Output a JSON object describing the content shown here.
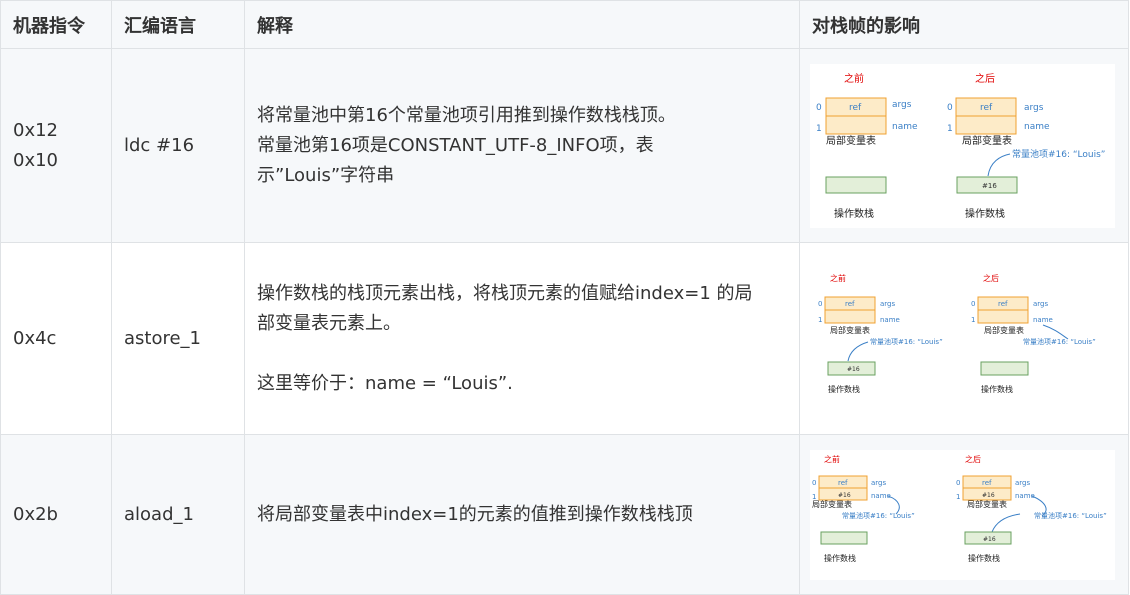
{
  "headers": [
    "机器指令",
    "汇编语言",
    "解释",
    "对栈帧的影响"
  ],
  "rows": [
    {
      "machine": [
        "0x12",
        "0x10"
      ],
      "asm": "ldc #16",
      "explain": [
        "将常量池中第16个常量池项引用推到操作数栈栈顶。",
        "常量池第16项是CONSTANT_UTF-8_INFO项，表",
        "示”Louis”字符串"
      ]
    },
    {
      "machine": [
        "0x4c"
      ],
      "asm": "astore_1",
      "explain": [
        "操作数栈的栈顶元素出栈，将栈顶元素的值赋给index=1 的局",
        "部变量表元素上。",
        "",
        "这里等价于：name = “Louis”."
      ]
    },
    {
      "machine": [
        "0x2b"
      ],
      "asm": "aload_1",
      "explain": [
        "将局部变量表中index=1的元素的值推到操作数栈栈顶"
      ]
    }
  ],
  "diagram": {
    "before": "之前",
    "after": "之后",
    "idx0": "0",
    "idx1": "1",
    "ref": "ref",
    "args": "args",
    "name": "name",
    "lvt": "局部变量表",
    "stack": "操作数栈",
    "const": "常量池项#16: “Louis”",
    "item16": "#16",
    "colors": {
      "red": "#e00000",
      "orange": "#f0a030",
      "slot": "#fdebc8",
      "green": "#6aa060",
      "greenfill": "#e3efd9",
      "blue": "#3a7fc6"
    }
  }
}
